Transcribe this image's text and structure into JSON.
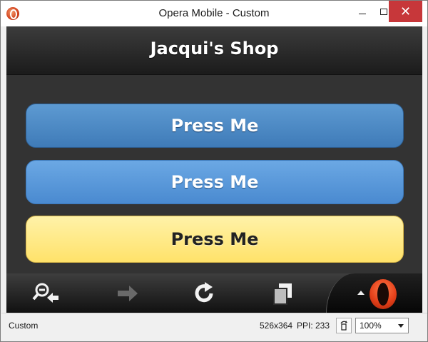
{
  "window": {
    "title": "Opera Mobile - Custom",
    "icon": "opera-icon"
  },
  "page": {
    "header_title": "Jacqui's Shop",
    "buttons": [
      {
        "label": "Press Me",
        "color": "#4a86c4"
      },
      {
        "label": "Press Me",
        "color": "#5a98da"
      },
      {
        "label": "Press Me",
        "color": "#ffe680"
      }
    ]
  },
  "toolbar": {
    "icons": [
      "zoom-back-icon",
      "forward-icon",
      "reload-icon",
      "tabs-icon",
      "opera-menu-icon"
    ]
  },
  "statusbar": {
    "profile": "Custom",
    "dimensions": "526x364",
    "ppi": "PPI: 233",
    "zoom": "100%"
  }
}
